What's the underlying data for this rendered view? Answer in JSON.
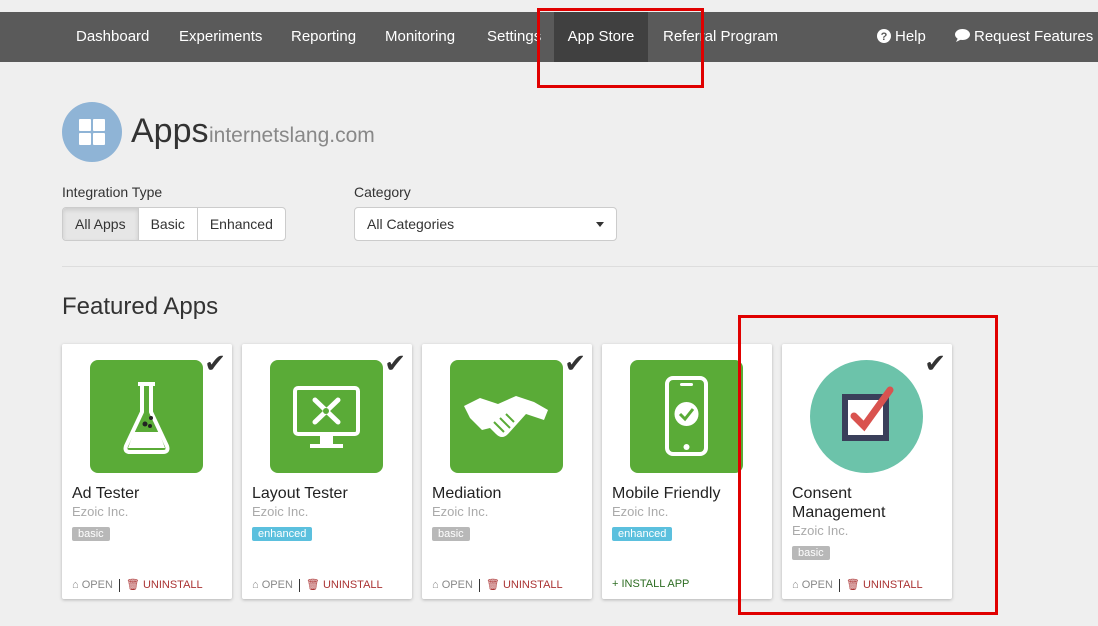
{
  "nav": {
    "items": [
      {
        "label": "Dashboard"
      },
      {
        "label": "Experiments"
      },
      {
        "label": "Reporting"
      },
      {
        "label": "Monitoring"
      },
      {
        "label": "Settings"
      },
      {
        "label": "App Store"
      },
      {
        "label": "Referral Program"
      }
    ],
    "help": "Help",
    "request": "Request Features"
  },
  "header": {
    "title": "Apps",
    "domain": "internetslang.com"
  },
  "filters": {
    "integration_label": "Integration Type",
    "integration_options": [
      "All Apps",
      "Basic",
      "Enhanced"
    ],
    "category_label": "Category",
    "category_value": "All Categories"
  },
  "featured": {
    "title": "Featured Apps",
    "apps": [
      {
        "name": "Ad Tester",
        "vendor": "Ezoic Inc.",
        "badge": "basic",
        "open": "OPEN",
        "uninstall": "UNINSTALL"
      },
      {
        "name": "Layout Tester",
        "vendor": "Ezoic Inc.",
        "badge": "enhanced",
        "open": "OPEN",
        "uninstall": "UNINSTALL"
      },
      {
        "name": "Mediation",
        "vendor": "Ezoic Inc.",
        "badge": "basic",
        "open": "OPEN",
        "uninstall": "UNINSTALL"
      },
      {
        "name": "Mobile Friendly",
        "vendor": "Ezoic Inc.",
        "badge": "enhanced",
        "install": "INSTALL APP"
      },
      {
        "name": "Consent Management",
        "vendor": "Ezoic Inc.",
        "badge": "basic",
        "open": "OPEN",
        "uninstall": "UNINSTALL"
      }
    ]
  },
  "colors": {
    "nav_bg": "#5a5a5a",
    "app_green": "#5aab37",
    "consent_teal": "#6cc3aa",
    "highlight": "#e00000"
  }
}
